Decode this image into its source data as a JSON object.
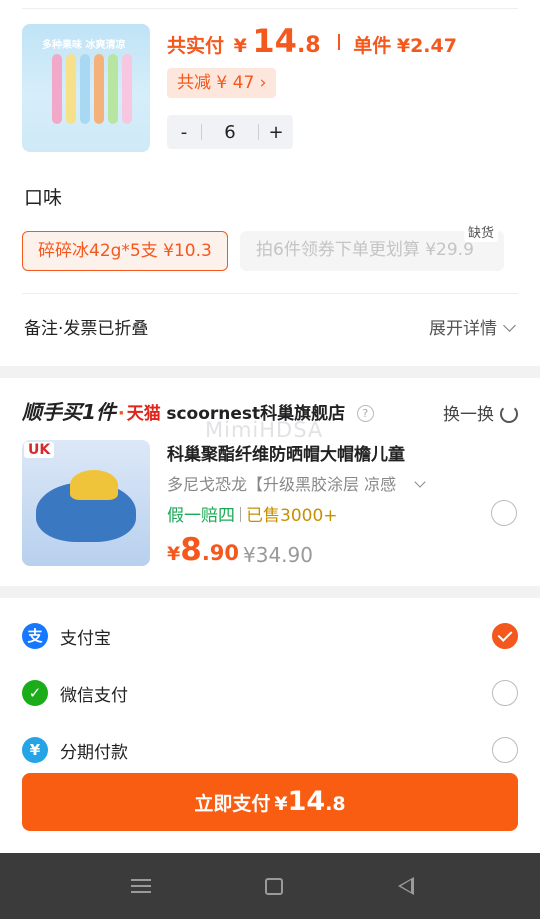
{
  "order_item": {
    "image_text": "多种果味 冰爽清凉",
    "total_label": "共实付",
    "currency": "¥",
    "total_int": "14",
    "total_dec": ".8",
    "unit_label": "单件",
    "unit_price": "¥2.47",
    "discount_label": "共减 ¥ 47 ›",
    "quantity": {
      "minus": "-",
      "value": "6",
      "plus": "+"
    }
  },
  "flavor": {
    "title": "口味",
    "options": [
      {
        "label": "碎碎冰42g*5支  ¥10.3",
        "selected": true
      },
      {
        "label": "拍6件领券下单更划算  ¥29.9",
        "disabled": true
      }
    ],
    "out_of_stock_label": "缺货"
  },
  "notes": {
    "label": "备注·发票已折叠",
    "expand_label": "展开详情"
  },
  "add_on": {
    "title": "顺手买1件",
    "dot": "·",
    "platform": "天猫",
    "store": "scoornest科巢旗舰店",
    "help_glyph": "?",
    "swap_label": "换一换",
    "image_badge": "UK",
    "product_name": "科巢聚酯纤维防晒帽大帽檐儿童",
    "variant": "多尼戈恐龙【升级黑胶涂层 凉感",
    "badge_guarantee": "假一赔四",
    "badge_sold": "已售3000+",
    "price_currency": "¥",
    "price_int": "8",
    "price_dec": ".90",
    "original_price": "¥34.90"
  },
  "payment_methods": [
    {
      "label": "支付宝",
      "icon": "alipay-icon",
      "icon_glyph": "支",
      "color": "#1677ff",
      "selected": true
    },
    {
      "label": "微信支付",
      "icon": "wechat-pay-icon",
      "icon_glyph": "✓",
      "color": "#1aad19",
      "selected": false
    },
    {
      "label": "分期付款",
      "icon": "installment-icon",
      "icon_glyph": "¥",
      "color": "#26a4e8",
      "selected": false
    }
  ],
  "pay_button": {
    "label": "立即支付",
    "currency": "¥",
    "amount_int": "14",
    "amount_dec": ".8"
  },
  "watermark": "MimiHDSA",
  "colors": {
    "accent": "#f4581d",
    "button": "#f95d12",
    "green": "#1aaa55",
    "gold": "#c79000"
  }
}
